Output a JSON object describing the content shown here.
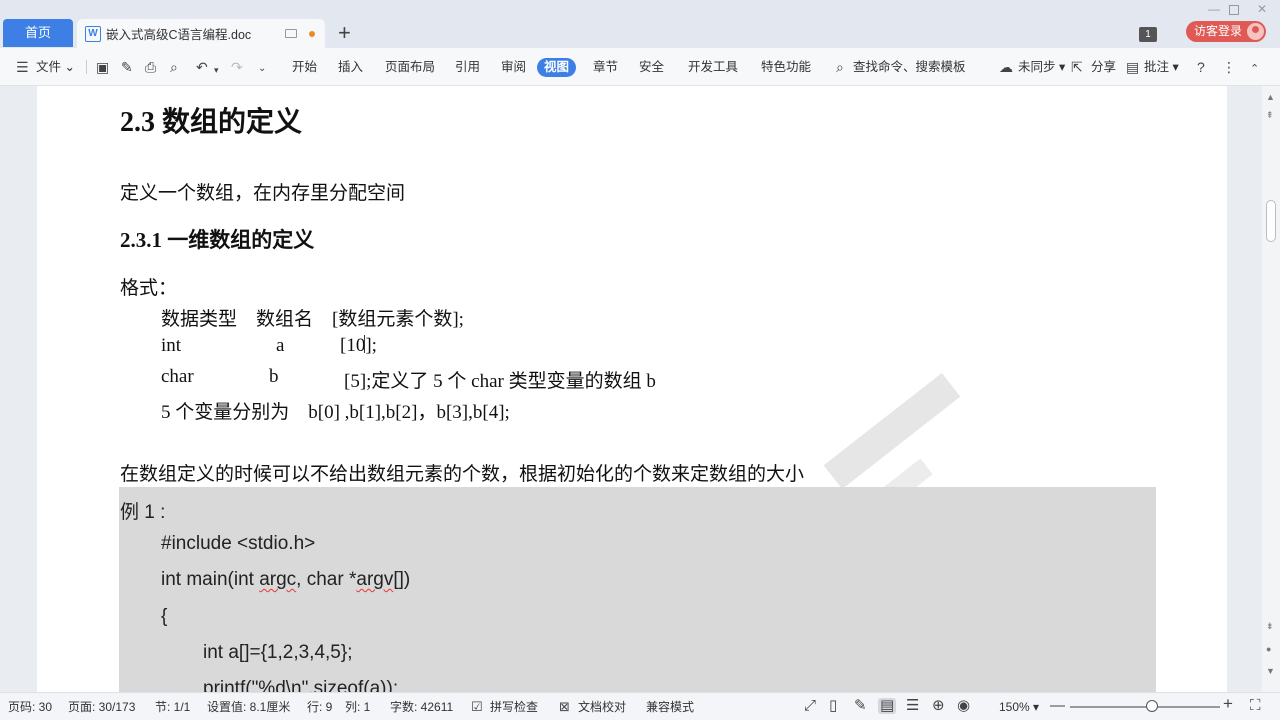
{
  "tabs": {
    "home": "首页",
    "doc_title": "嵌入式高级C语言编程.doc"
  },
  "header": {
    "window_badge": "1",
    "login_label": "访客登录"
  },
  "ribbon": {
    "file_label": "文件",
    "tabs": [
      "开始",
      "插入",
      "页面布局",
      "引用",
      "审阅",
      "视图",
      "章节",
      "安全",
      "开发工具",
      "特色功能"
    ],
    "active_tab": "视图",
    "search_label": "查找命令、搜索模板",
    "sync_label": "未同步",
    "share_label": "分享",
    "comment_label": "批注"
  },
  "document": {
    "h2": "2.3  数组的定义",
    "intro": "定义一个数组，在内存里分配空间",
    "h3": "2.3.1  一维数组的定义",
    "format_label": "格式：",
    "line1": "数据类型    数组名    [数组元素个数];",
    "line2a": "int",
    "line2b": "a",
    "line2c": "[10];",
    "line3a": "char",
    "line3b": "b",
    "line3c": "[5];定义了 5 个 char 类型变量的数组 b",
    "line4": "5 个变量分别为    b[0] ,b[1],b[2]，b[3],b[4];",
    "para2": "在数组定义的时候可以不给出数组元素的个数，根据初始化的个数来定数组的大小",
    "example_label": "例 1 :",
    "code": {
      "include": "#include <stdio.h>",
      "main_pre": "int main(int ",
      "main_argc": "argc",
      "main_mid": ", char *",
      "main_argv": "argv",
      "main_post": "[])",
      "brace": "{",
      "decl": "int a[]={1,2,3,4,5};",
      "printf": "printf(\"%d\\n\",sizeof(a));"
    }
  },
  "statusbar": {
    "page_code": "页码: 30",
    "page": "页面: 30/173",
    "section": "节: 1/1",
    "setting": "设置值: 8.1厘米",
    "row": "行: 9",
    "col": "列: 1",
    "word_count": "字数: 42611",
    "spell_check": "拼写检查",
    "doc_proof": "文档校对",
    "compat_mode": "兼容模式",
    "zoom": "150%"
  },
  "colors": {
    "accent": "#3d7fe4",
    "login": "#e05a55",
    "code_bg": "#d9d9d9"
  }
}
